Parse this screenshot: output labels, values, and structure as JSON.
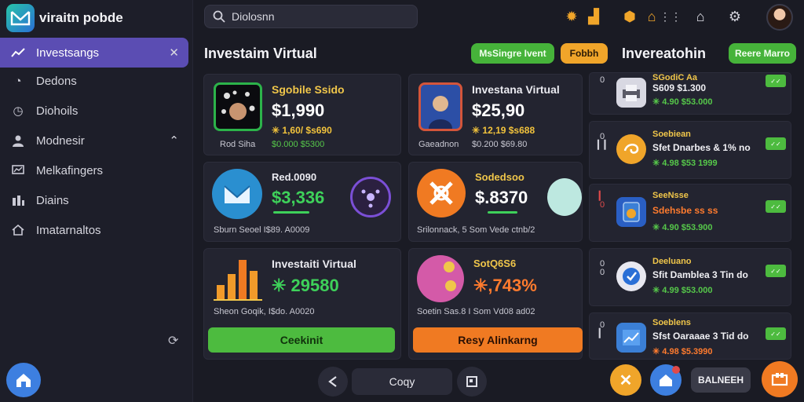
{
  "app": {
    "brand": "viraitn pobde"
  },
  "sidebar": {
    "items": [
      {
        "label": "Investsangs",
        "icon": "trend-icon"
      },
      {
        "label": "Dedons",
        "icon": "chart-icon"
      },
      {
        "label": "Diohoils",
        "icon": "clock-icon"
      },
      {
        "label": "Modnesir",
        "icon": "user-icon"
      },
      {
        "label": "Melkafingers",
        "icon": "monitor-icon"
      },
      {
        "label": "Diains",
        "icon": "bars-icon"
      },
      {
        "label": "Imatarnaltos",
        "icon": "home-icon"
      }
    ]
  },
  "search": {
    "value": "Diolosnn"
  },
  "main": {
    "title": "Investaim Virtual",
    "btn_green": "MsSingre Ivent",
    "btn_orange": "Fobbh",
    "cards": [
      {
        "name": "Sgobile Ssido",
        "value": "$1,990",
        "delta": "✳ 1,60/ $s690",
        "foot_left": "Rod Siha",
        "foot_right": "$0.000 $5300",
        "value_color": "#ffffff",
        "delta_color": "#f2c33c"
      },
      {
        "name": "Investana Virtual",
        "value": "$25,90",
        "delta": "✳ 12,19 $s688",
        "foot_left": "Gaeadnon",
        "foot_right": "$0.200 $69.80",
        "value_color": "#ffffff",
        "delta_color": "#f2c33c"
      },
      {
        "name": "Red.0090",
        "value": "$3,336",
        "delta": "",
        "foot": "Sburn Seoel I$89. A0009",
        "value_color": "#3ed15a",
        "delta_color": "#ffffff"
      },
      {
        "name": "Sodedsoo",
        "value": "$.8370",
        "delta": "",
        "foot": "Srilonnack, 5 Som Vede ctnb/2",
        "value_color": "#ffffff",
        "delta_color": "#ffffff"
      },
      {
        "name": "Investaiti Virtual",
        "value": "✳ 29580",
        "delta": "",
        "foot": "Sheon Goqik, I$do. A0020",
        "value_color": "#3ed15a",
        "delta_color": "#ffffff"
      },
      {
        "name": "SotQ6S6",
        "value": "✳,743%",
        "delta": "",
        "foot": "Soetin Sas.8 I Som Vd08 ad02",
        "value_color": "#ff7b2e",
        "delta_color": "#ffffff"
      }
    ],
    "cta_left": "Ceekinit",
    "cta_right": "Resy Alinkarng"
  },
  "right": {
    "title": "Invereatohin",
    "btn": "Reere Marro",
    "items": [
      {
        "num": "0",
        "title": "SGodiC Aa",
        "sub": "S609 $1.300",
        "val": "✳ 4.90 $53.000",
        "badge": "✓✓",
        "icon_color": "#e8e8ee"
      },
      {
        "num": "0\n▎▎",
        "title": "Soebiean",
        "sub": "Sfet Dnarbes & 1% no",
        "val": "✳ 4.98 $53 1999",
        "badge": "✓✓",
        "icon_color": "#f0a52a"
      },
      {
        "num": "▎\n0",
        "title": "SeeNsse",
        "sub": "Sdehsbe ss ss",
        "val": "✳ 4.90 $53.900",
        "badge": "✓✓",
        "icon_color": "#3b7fd6"
      },
      {
        "num": "0\n0",
        "title": "Deeluano",
        "sub": "Sfit Damblea 3 Tin do",
        "val": "✳ 4.99 $53.000",
        "badge": "✓✓",
        "icon_color": "#3b7fd6"
      },
      {
        "num": "0\n▎",
        "title": "Soeblens",
        "sub": "Sfst Oaraaae 3 Tid do",
        "val": "✳ 4.98 $5.3990",
        "badge": "✓✓",
        "icon_color": "#3b7fd6"
      }
    ]
  },
  "bottom": {
    "center_label": "Coqy",
    "right_label": "BALNEEH"
  },
  "colors": {
    "accent": "#5b4db3",
    "green": "#46b33a",
    "orange": "#f0a52a",
    "bg": "#1a1b24"
  }
}
